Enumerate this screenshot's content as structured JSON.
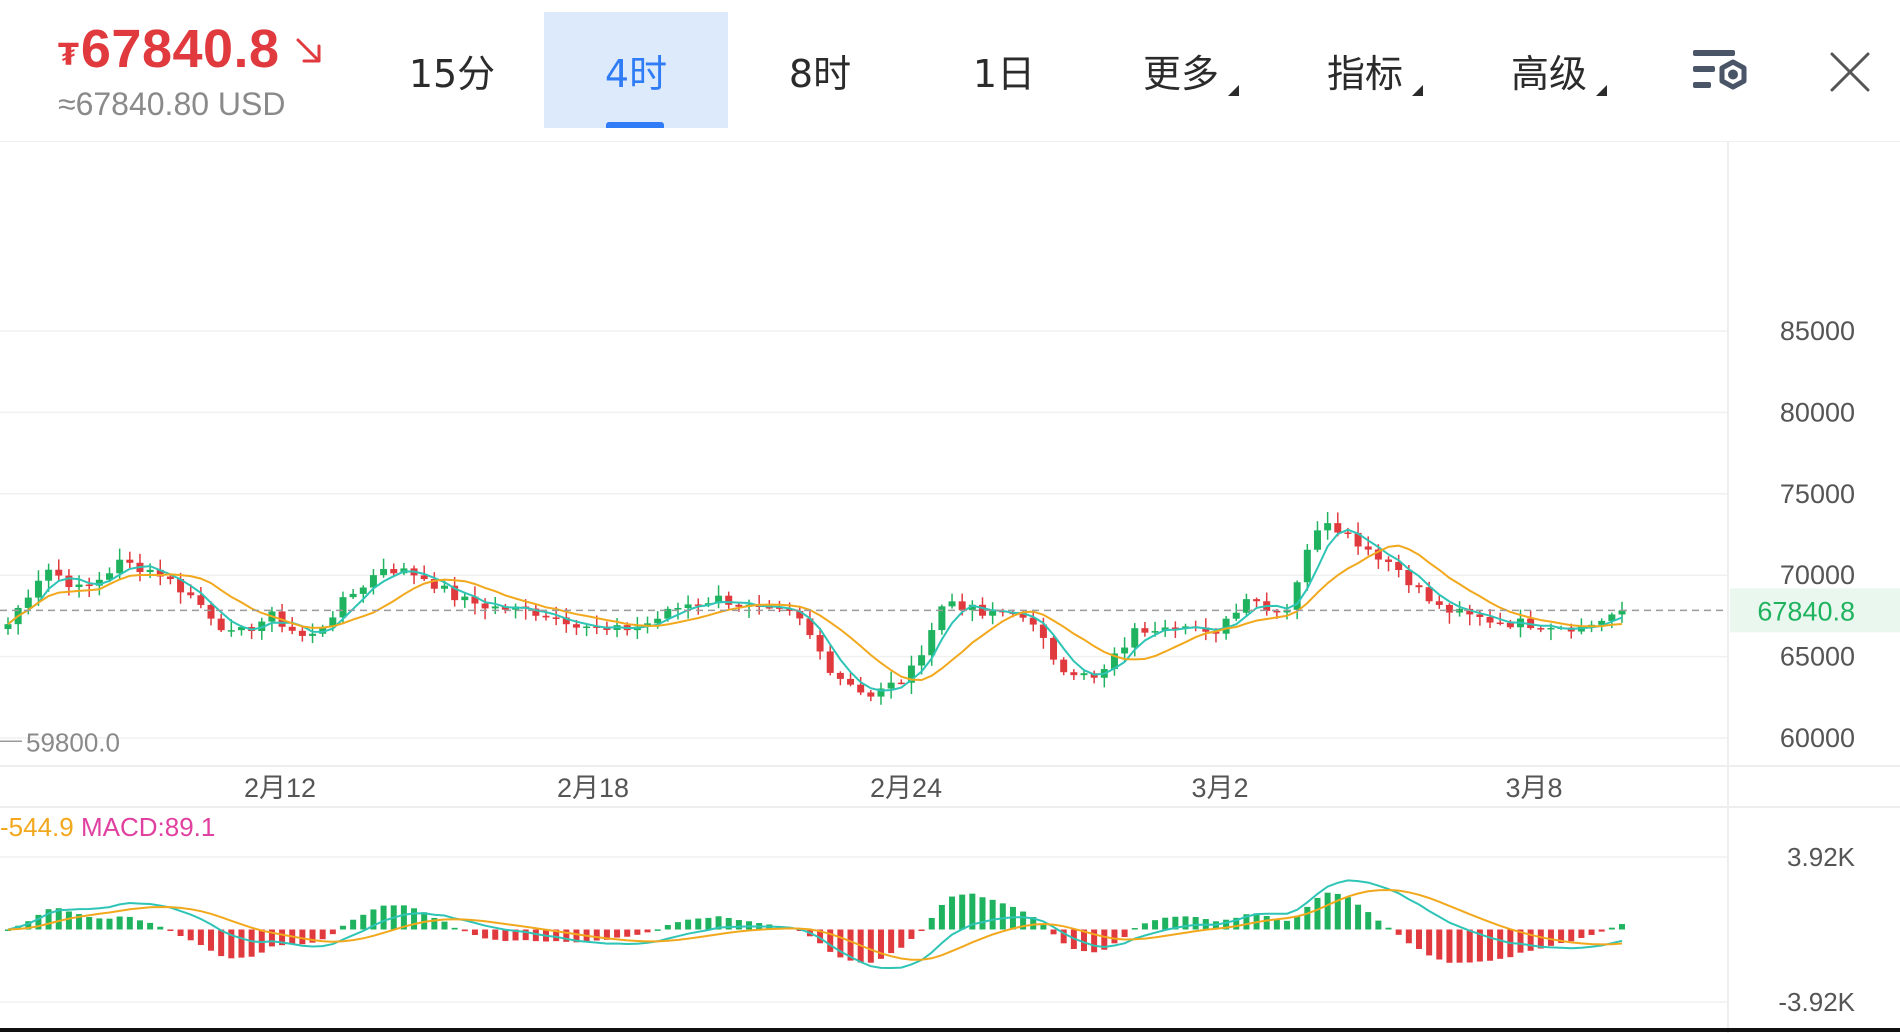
{
  "header": {
    "currency_symbol": "₮",
    "price": "67840.8",
    "price_usd": "≈67840.80 USD",
    "trend": "down"
  },
  "tabs": [
    {
      "label": "15分",
      "active": false
    },
    {
      "label": "4时",
      "active": true
    },
    {
      "label": "8时",
      "active": false
    },
    {
      "label": "1日",
      "active": false
    },
    {
      "label": "更多",
      "active": false,
      "dropdown": true
    },
    {
      "label": "指标",
      "active": false,
      "dropdown": true
    },
    {
      "label": "高级",
      "active": false,
      "dropdown": true
    }
  ],
  "icons": {
    "settings": "chart-settings-icon",
    "close": "close-icon",
    "trend": "arrow-down-right-icon"
  },
  "colors": {
    "up": "#e0393e",
    "down": "#1fb35f",
    "accent": "#2f7cf6",
    "ma_fast": "#2ec4b6",
    "ma_slow": "#f2a81d",
    "macd_label": "#e040a0",
    "dea_label": "#f2a81d"
  },
  "chart_data": {
    "type": "candlestick",
    "price_axis": {
      "ticks": [
        "85000",
        "80000",
        "75000",
        "70000",
        "65000",
        "60000"
      ],
      "range": [
        60000,
        85000
      ]
    },
    "current_price_label": "67840.8",
    "current_price": 67840.8,
    "low_marker_label": "59800.0",
    "low_marker": 59800.0,
    "x_ticks": [
      "2月12",
      "2月18",
      "2月24",
      "3月2",
      "3月8"
    ],
    "close_path": [
      67000,
      70500,
      69000,
      70800,
      70200,
      68500,
      66200,
      67500,
      66000,
      68500,
      70500,
      70000,
      68500,
      68000,
      67800,
      67200,
      66500,
      67000,
      68200,
      68600,
      67800,
      67500,
      64000,
      62600,
      63800,
      68600,
      67500,
      67800,
      64500,
      63500,
      66500,
      67200,
      66200,
      68700,
      67600,
      73700,
      72000,
      70500,
      68100,
      67400,
      67100,
      67000,
      66800,
      67840
    ],
    "macd": {
      "dea_label": "-544.9",
      "macd_label": "MACD:89.1",
      "dea": -544.9,
      "macd": 89.1,
      "axis_ticks": [
        "3.92K",
        "-3.92K"
      ],
      "range": [
        -3920,
        3920
      ]
    }
  }
}
